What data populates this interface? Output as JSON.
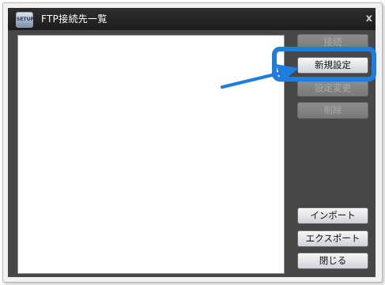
{
  "window": {
    "title": "FTP接続先一覧",
    "app_icon": "app-icon",
    "close_glyph": "x"
  },
  "buttons": {
    "connect": "接続",
    "new_setting": "新規設定",
    "edit_setting": "設定変更",
    "delete": "削除",
    "import": "インポート",
    "export": "エクスポート",
    "close": "閉じる"
  },
  "colors": {
    "annotation": "#1f7de0",
    "window_bg": "#474747"
  }
}
